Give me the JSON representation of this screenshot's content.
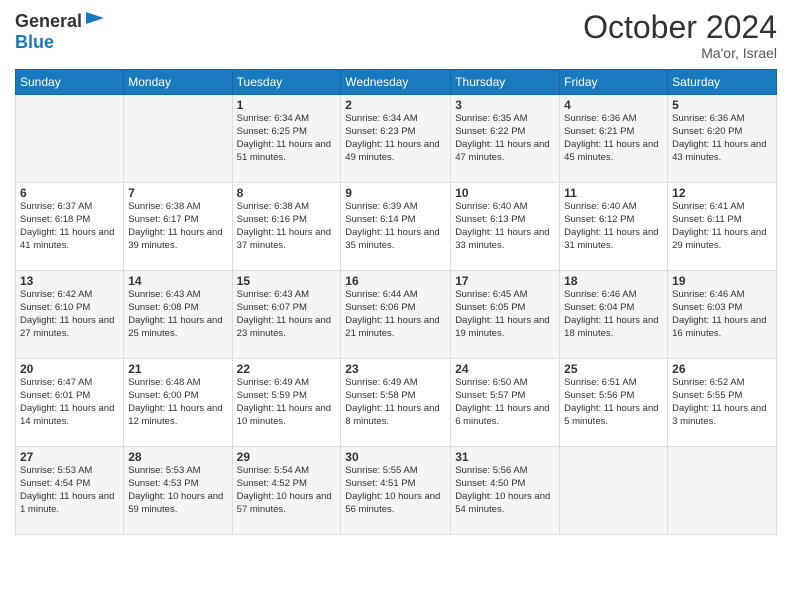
{
  "logo": {
    "general": "General",
    "blue": "Blue"
  },
  "header": {
    "month": "October 2024",
    "location": "Ma'or, Israel"
  },
  "weekdays": [
    "Sunday",
    "Monday",
    "Tuesday",
    "Wednesday",
    "Thursday",
    "Friday",
    "Saturday"
  ],
  "weeks": [
    [
      {
        "day": "",
        "info": ""
      },
      {
        "day": "",
        "info": ""
      },
      {
        "day": "1",
        "info": "Sunrise: 6:34 AM\nSunset: 6:25 PM\nDaylight: 11 hours and 51 minutes."
      },
      {
        "day": "2",
        "info": "Sunrise: 6:34 AM\nSunset: 6:23 PM\nDaylight: 11 hours and 49 minutes."
      },
      {
        "day": "3",
        "info": "Sunrise: 6:35 AM\nSunset: 6:22 PM\nDaylight: 11 hours and 47 minutes."
      },
      {
        "day": "4",
        "info": "Sunrise: 6:36 AM\nSunset: 6:21 PM\nDaylight: 11 hours and 45 minutes."
      },
      {
        "day": "5",
        "info": "Sunrise: 6:36 AM\nSunset: 6:20 PM\nDaylight: 11 hours and 43 minutes."
      }
    ],
    [
      {
        "day": "6",
        "info": "Sunrise: 6:37 AM\nSunset: 6:18 PM\nDaylight: 11 hours and 41 minutes."
      },
      {
        "day": "7",
        "info": "Sunrise: 6:38 AM\nSunset: 6:17 PM\nDaylight: 11 hours and 39 minutes."
      },
      {
        "day": "8",
        "info": "Sunrise: 6:38 AM\nSunset: 6:16 PM\nDaylight: 11 hours and 37 minutes."
      },
      {
        "day": "9",
        "info": "Sunrise: 6:39 AM\nSunset: 6:14 PM\nDaylight: 11 hours and 35 minutes."
      },
      {
        "day": "10",
        "info": "Sunrise: 6:40 AM\nSunset: 6:13 PM\nDaylight: 11 hours and 33 minutes."
      },
      {
        "day": "11",
        "info": "Sunrise: 6:40 AM\nSunset: 6:12 PM\nDaylight: 11 hours and 31 minutes."
      },
      {
        "day": "12",
        "info": "Sunrise: 6:41 AM\nSunset: 6:11 PM\nDaylight: 11 hours and 29 minutes."
      }
    ],
    [
      {
        "day": "13",
        "info": "Sunrise: 6:42 AM\nSunset: 6:10 PM\nDaylight: 11 hours and 27 minutes."
      },
      {
        "day": "14",
        "info": "Sunrise: 6:43 AM\nSunset: 6:08 PM\nDaylight: 11 hours and 25 minutes."
      },
      {
        "day": "15",
        "info": "Sunrise: 6:43 AM\nSunset: 6:07 PM\nDaylight: 11 hours and 23 minutes."
      },
      {
        "day": "16",
        "info": "Sunrise: 6:44 AM\nSunset: 6:06 PM\nDaylight: 11 hours and 21 minutes."
      },
      {
        "day": "17",
        "info": "Sunrise: 6:45 AM\nSunset: 6:05 PM\nDaylight: 11 hours and 19 minutes."
      },
      {
        "day": "18",
        "info": "Sunrise: 6:46 AM\nSunset: 6:04 PM\nDaylight: 11 hours and 18 minutes."
      },
      {
        "day": "19",
        "info": "Sunrise: 6:46 AM\nSunset: 6:03 PM\nDaylight: 11 hours and 16 minutes."
      }
    ],
    [
      {
        "day": "20",
        "info": "Sunrise: 6:47 AM\nSunset: 6:01 PM\nDaylight: 11 hours and 14 minutes."
      },
      {
        "day": "21",
        "info": "Sunrise: 6:48 AM\nSunset: 6:00 PM\nDaylight: 11 hours and 12 minutes."
      },
      {
        "day": "22",
        "info": "Sunrise: 6:49 AM\nSunset: 5:59 PM\nDaylight: 11 hours and 10 minutes."
      },
      {
        "day": "23",
        "info": "Sunrise: 6:49 AM\nSunset: 5:58 PM\nDaylight: 11 hours and 8 minutes."
      },
      {
        "day": "24",
        "info": "Sunrise: 6:50 AM\nSunset: 5:57 PM\nDaylight: 11 hours and 6 minutes."
      },
      {
        "day": "25",
        "info": "Sunrise: 6:51 AM\nSunset: 5:56 PM\nDaylight: 11 hours and 5 minutes."
      },
      {
        "day": "26",
        "info": "Sunrise: 6:52 AM\nSunset: 5:55 PM\nDaylight: 11 hours and 3 minutes."
      }
    ],
    [
      {
        "day": "27",
        "info": "Sunrise: 5:53 AM\nSunset: 4:54 PM\nDaylight: 11 hours and 1 minute."
      },
      {
        "day": "28",
        "info": "Sunrise: 5:53 AM\nSunset: 4:53 PM\nDaylight: 10 hours and 59 minutes."
      },
      {
        "day": "29",
        "info": "Sunrise: 5:54 AM\nSunset: 4:52 PM\nDaylight: 10 hours and 57 minutes."
      },
      {
        "day": "30",
        "info": "Sunrise: 5:55 AM\nSunset: 4:51 PM\nDaylight: 10 hours and 56 minutes."
      },
      {
        "day": "31",
        "info": "Sunrise: 5:56 AM\nSunset: 4:50 PM\nDaylight: 10 hours and 54 minutes."
      },
      {
        "day": "",
        "info": ""
      },
      {
        "day": "",
        "info": ""
      }
    ]
  ]
}
